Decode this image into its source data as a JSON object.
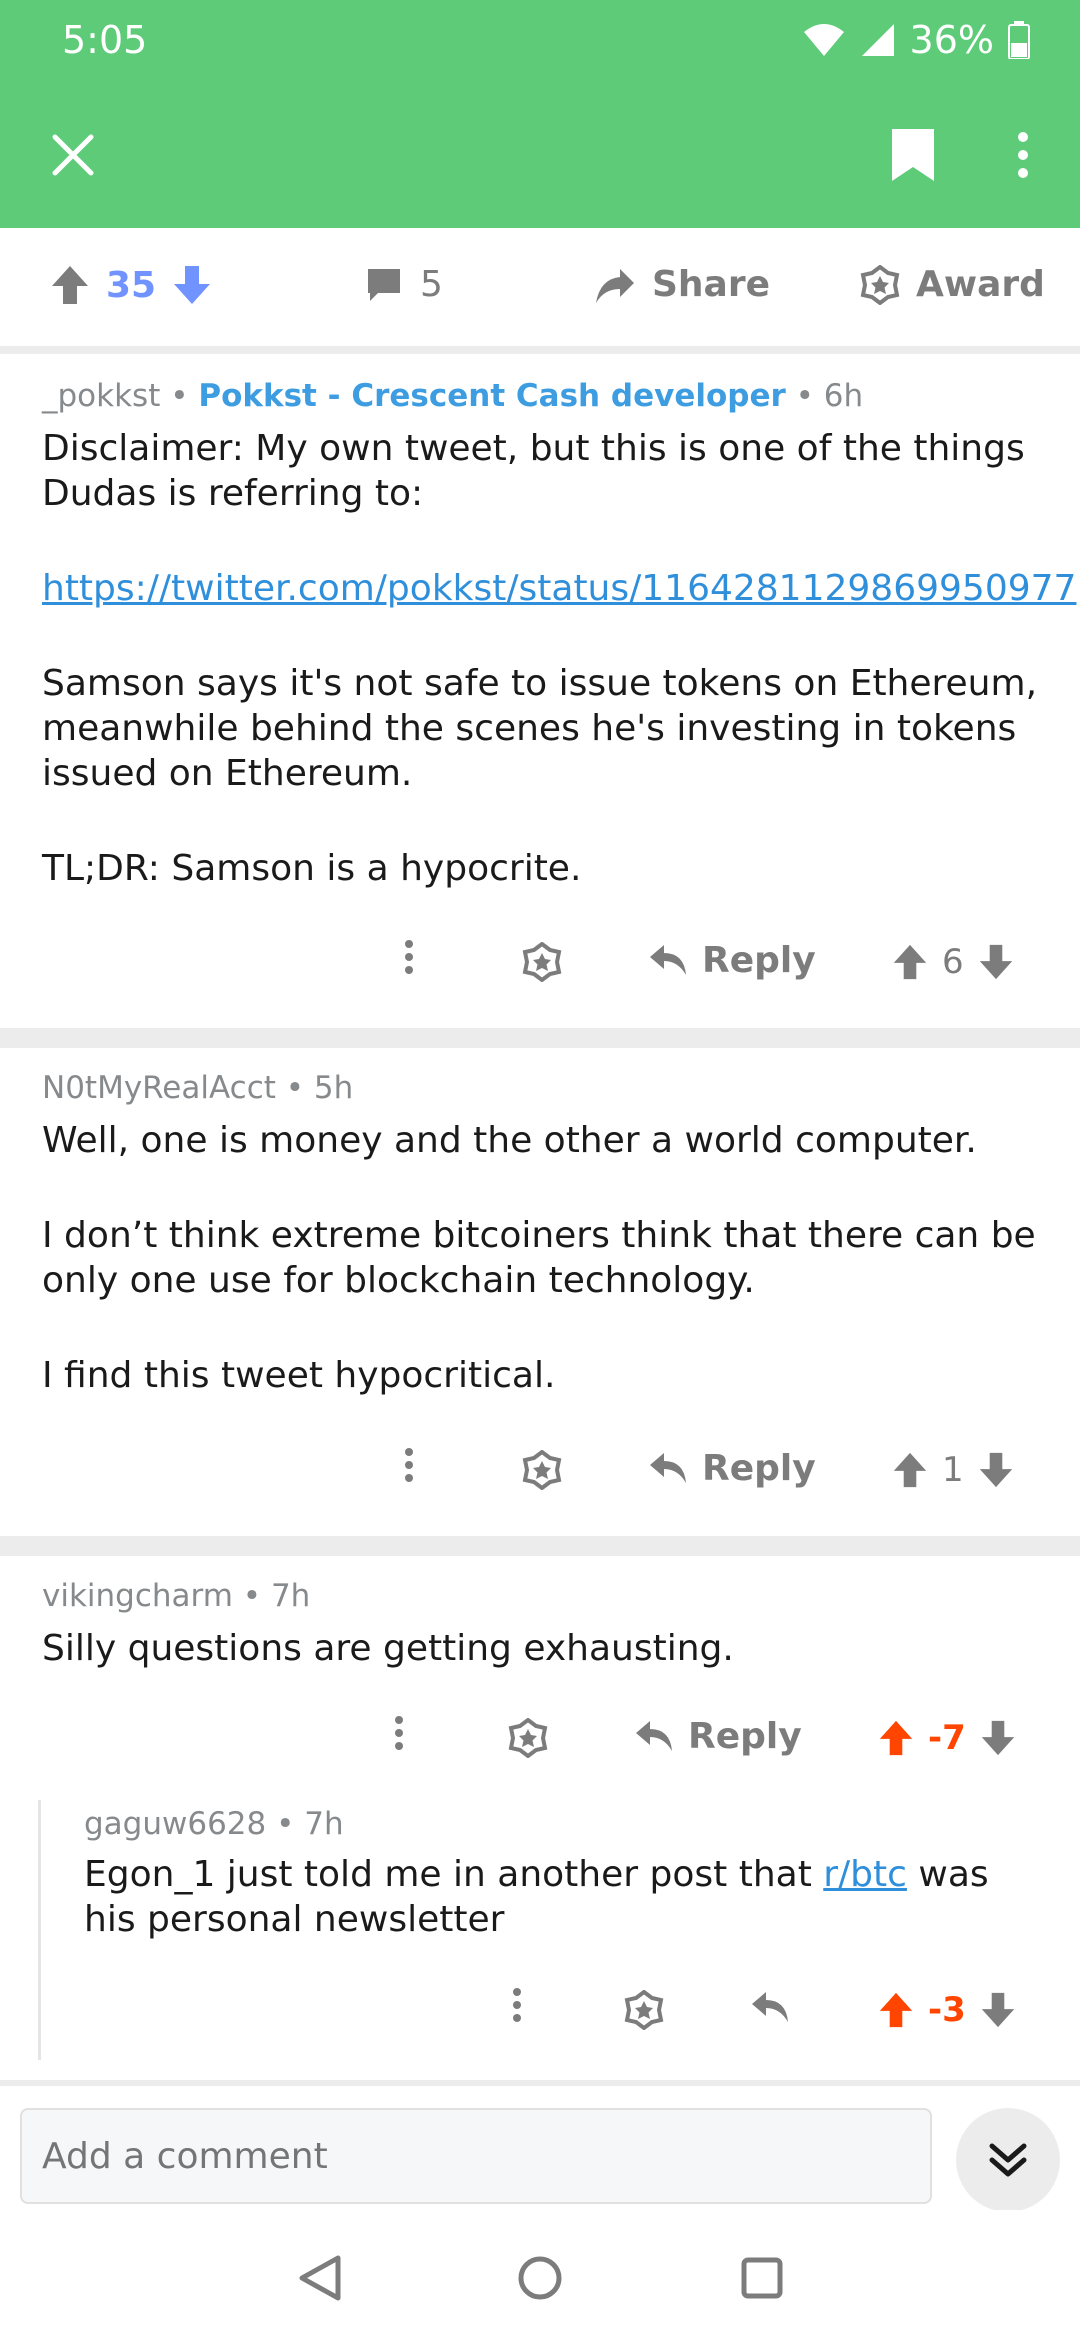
{
  "status": {
    "time": "5:05",
    "battery": "36%"
  },
  "toolbar": {},
  "post_actions": {
    "score": "35",
    "comments": "5",
    "share": "Share",
    "award": "Award"
  },
  "comments": [
    {
      "author": "_pokkst",
      "flair": "Pokkst - Crescent Cash developer",
      "age": "6h",
      "para1": "Disclaimer: My own tweet, but this is one of the things Dudas is referring to:",
      "link": "https://twitter.com/pokkst/status/1164281129869950977",
      "para2": "Samson says it's not safe to issue tokens on Ethereum, meanwhile behind the scenes he's investing in tokens issued on Ethereum.",
      "para3": "TL;DR: Samson is a hypocrite.",
      "reply": "Reply",
      "score": "6"
    },
    {
      "author": "N0tMyRealAcct",
      "age": "5h",
      "para1": "Well, one is money and the other a world computer.",
      "para2": "I don’t think extreme bitcoiners think that there can be only one use for blockchain technology.",
      "para3": "I find this tweet hypocritical.",
      "reply": "Reply",
      "score": "1"
    },
    {
      "author": "vikingcharm",
      "age": "7h",
      "para1": "Silly questions are getting exhausting.",
      "reply": "Reply",
      "score": "-7"
    },
    {
      "author": "gaguw6628",
      "age": "7h",
      "text_before": "Egon_1 just told me in another post that ",
      "link": "r/btc",
      "text_after": " was his personal newsletter",
      "score": "-3"
    }
  ],
  "composer": {
    "placeholder": "Add a comment"
  },
  "colors": {
    "header": "#5ecb78",
    "upvote_blue": "#7193ff",
    "downvote_orange": "#ff4500",
    "flair_blue": "#3d9de0"
  }
}
